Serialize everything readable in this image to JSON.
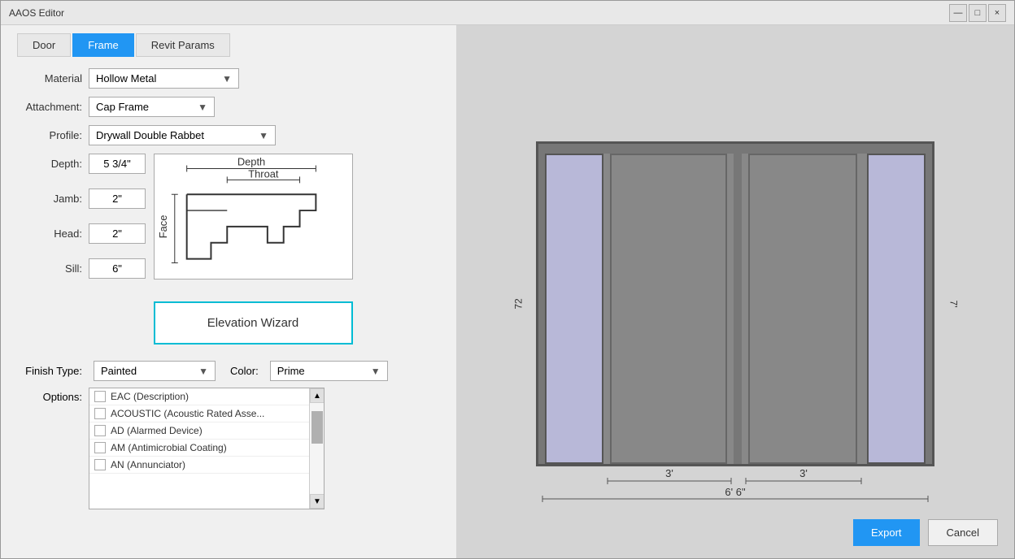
{
  "window": {
    "title": "AAOS Editor",
    "title_buttons": [
      "—",
      "□",
      "×"
    ]
  },
  "tabs": [
    {
      "label": "Door",
      "active": false
    },
    {
      "label": "Frame",
      "active": true
    },
    {
      "label": "Revit Params",
      "active": false
    }
  ],
  "form": {
    "material_label": "Material",
    "material_value": "Hollow Metal",
    "attachment_label": "Attachment:",
    "attachment_value": "Cap Frame",
    "profile_label": "Profile:",
    "profile_value": "Drywall Double Rabbet",
    "depth_label": "Depth:",
    "depth_value": "5 3/4\"",
    "jamb_label": "Jamb:",
    "jamb_value": "2\"",
    "head_label": "Head:",
    "head_value": "2\"",
    "sill_label": "Sill:",
    "sill_value": "6\""
  },
  "elevation_wizard": {
    "label": "Elevation Wizard"
  },
  "finish": {
    "type_label": "Finish Type:",
    "type_value": "Painted",
    "color_label": "Color:",
    "color_value": "Prime"
  },
  "options": {
    "label": "Options:",
    "items": [
      {
        "code": "EAC (Description)",
        "checked": false
      },
      {
        "code": "ACOUSTIC (Acoustic Rated Asse...",
        "checked": false
      },
      {
        "code": "AD (Alarmed Device)",
        "checked": false
      },
      {
        "code": "AM (Antimicrobial Coating)",
        "checked": false
      },
      {
        "code": "AN (Annunciator)",
        "checked": false
      }
    ]
  },
  "diagram": {
    "depth_label": "Depth",
    "throat_label": "Throat",
    "face_label": "Face"
  },
  "elevation": {
    "dim_72": "72",
    "dim_3_left": "3'",
    "dim_3_right": "3'",
    "dim_66": "6' 6\"",
    "dim_7": "7'"
  },
  "buttons": {
    "export": "Export",
    "cancel": "Cancel"
  }
}
